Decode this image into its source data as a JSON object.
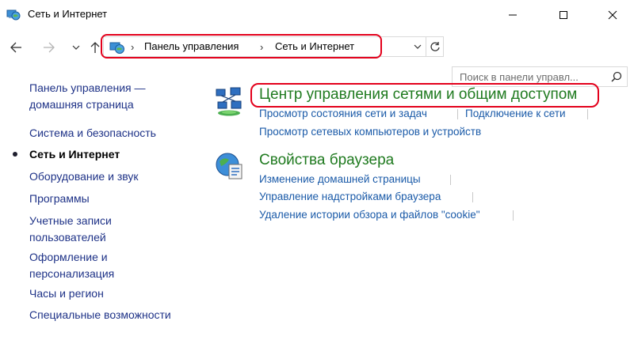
{
  "window": {
    "title": "Сеть и Интернет"
  },
  "address": {
    "crumbs": [
      "Панель управления",
      "Сеть и Интернет"
    ]
  },
  "search": {
    "placeholder": "Поиск в панели управл..."
  },
  "sidebar": {
    "items": [
      {
        "label_line1": "Панель управления —",
        "label_line2": "домашняя страница"
      },
      {
        "label": "Система и безопасность"
      },
      {
        "label": "Сеть и Интернет",
        "active": true
      },
      {
        "label": "Оборудование и звук"
      },
      {
        "label": "Программы"
      },
      {
        "label_line1": "Учетные записи",
        "label_line2": "пользователей"
      },
      {
        "label_line1": "Оформление и",
        "label_line2": "персонализация"
      },
      {
        "label": "Часы и регион"
      },
      {
        "label": "Специальные возможности"
      }
    ]
  },
  "categories": [
    {
      "title": "Центр управления сетями и общим доступом",
      "icon": "network-center-icon",
      "links": [
        "Просмотр состояния сети и задач",
        "Подключение к сети",
        "Просмотр сетевых компьютеров и устройств"
      ]
    },
    {
      "title": "Свойства браузера",
      "icon": "internet-options-icon",
      "links": [
        "Изменение домашней страницы",
        "Управление надстройками браузера",
        "Удаление истории обзора и файлов \"cookie\""
      ]
    }
  ],
  "colors": {
    "highlight": "#e3001b",
    "category_title": "#1f7a1f",
    "link": "#1a5aa8",
    "nav_link": "#1e3287"
  }
}
